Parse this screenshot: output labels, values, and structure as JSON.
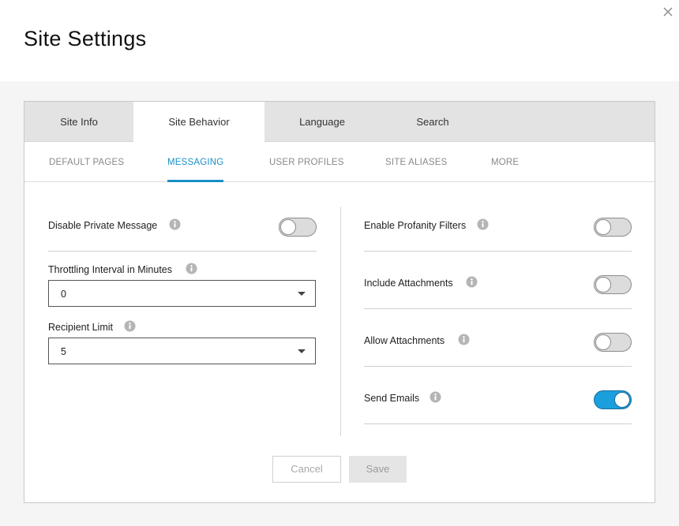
{
  "dialog": {
    "title": "Site Settings",
    "close_icon": "close-icon"
  },
  "tabs": [
    {
      "label": "Site Info",
      "active": false
    },
    {
      "label": "Site Behavior",
      "active": true
    },
    {
      "label": "Language",
      "active": false
    },
    {
      "label": "Search",
      "active": false
    }
  ],
  "subtabs": [
    {
      "label": "DEFAULT PAGES",
      "active": false
    },
    {
      "label": "MESSAGING",
      "active": true
    },
    {
      "label": "USER PROFILES",
      "active": false
    },
    {
      "label": "SITE ALIASES",
      "active": false
    },
    {
      "label": "MORE",
      "active": false
    }
  ],
  "left": {
    "disable_private_message": {
      "label": "Disable Private Message",
      "on": false
    },
    "throttling_interval": {
      "label": "Throttling Interval in Minutes",
      "value": "0"
    },
    "recipient_limit": {
      "label": "Recipient Limit",
      "value": "5"
    }
  },
  "right": {
    "enable_profanity_filters": {
      "label": "Enable Profanity Filters",
      "on": false
    },
    "include_attachments": {
      "label": "Include Attachments",
      "on": false
    },
    "allow_attachments": {
      "label": "Allow Attachments",
      "on": false
    },
    "send_emails": {
      "label": "Send Emails",
      "on": true
    }
  },
  "actions": {
    "cancel_label": "Cancel",
    "save_label": "Save"
  },
  "colors": {
    "accent": "#1a8fc6",
    "toggle_on": "#1a9fdc"
  }
}
